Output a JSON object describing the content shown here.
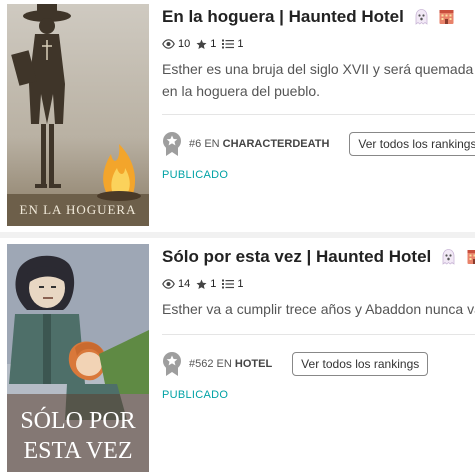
{
  "stories": [
    {
      "title": "En la hoguera | Haunted Hotel",
      "emojis": [
        "ghost-emoji",
        "hotel-emoji"
      ],
      "reads": "10",
      "votes": "1",
      "parts": "1",
      "description": "Esther es una bruja del siglo XVII y será quemada en la hoguera del pueblo.",
      "rank_number": "#6",
      "rank_en": "EN",
      "rank_tag": "CHARACTERDEATH",
      "rank_button": "Ver todos los rankings",
      "status": "PUBLICADO",
      "cover_text": "EN LA HOGUERA"
    },
    {
      "title": "Sólo por esta vez | Haunted Hotel",
      "emojis": [
        "ghost-emoji",
        "hotel-emoji"
      ],
      "reads": "14",
      "votes": "1",
      "parts": "1",
      "description": "Esther va a cumplir trece años y Abaddon nunca va a...",
      "rank_number": "#562",
      "rank_en": "EN",
      "rank_tag": "HOTEL",
      "rank_button": "Ver todos los rankings",
      "status": "PUBLICADO",
      "cover_text_line1": "SÓLO POR",
      "cover_text_line2": "ESTA VEZ"
    }
  ],
  "colors": {
    "status": "#00a2a5",
    "badge": "#9e9e9e"
  }
}
